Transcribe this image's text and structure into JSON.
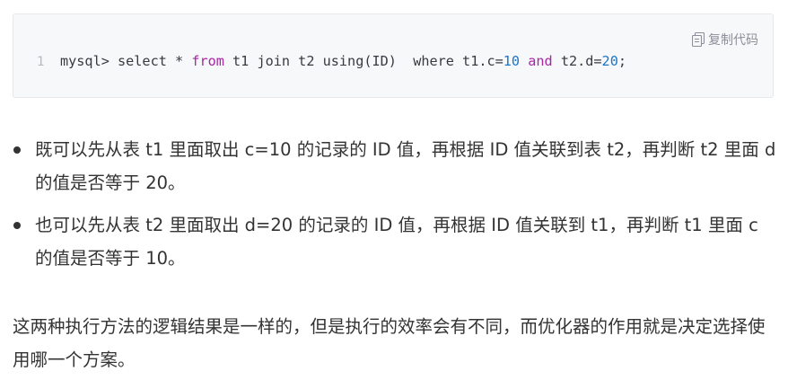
{
  "code_block": {
    "copy_label": "复制代码",
    "line_number": "1",
    "tokens": [
      {
        "text": "mysql> select * ",
        "type": "plain"
      },
      {
        "text": "from",
        "type": "keyword"
      },
      {
        "text": " t1 join t2 using(ID)  where t1.c=",
        "type": "plain"
      },
      {
        "text": "10",
        "type": "number"
      },
      {
        "text": " ",
        "type": "plain"
      },
      {
        "text": "and",
        "type": "keyword"
      },
      {
        "text": " t2.d=",
        "type": "plain"
      },
      {
        "text": "20",
        "type": "number"
      },
      {
        "text": ";",
        "type": "plain"
      }
    ]
  },
  "bullets": [
    "既可以先从表 t1 里面取出 c=10 的记录的 ID 值，再根据 ID 值关联到表 t2，再判断 t2 里面 d 的值是否等于 20。",
    "也可以先从表 t2 里面取出 d=20 的记录的 ID 值，再根据 ID 值关联到 t1，再判断 t1 里面 c 的值是否等于 10。"
  ],
  "paragraph": "这两种执行方法的逻辑结果是一样的，但是执行的效率会有不同，而优化器的作用就是决定选择使用哪一个方案。"
}
